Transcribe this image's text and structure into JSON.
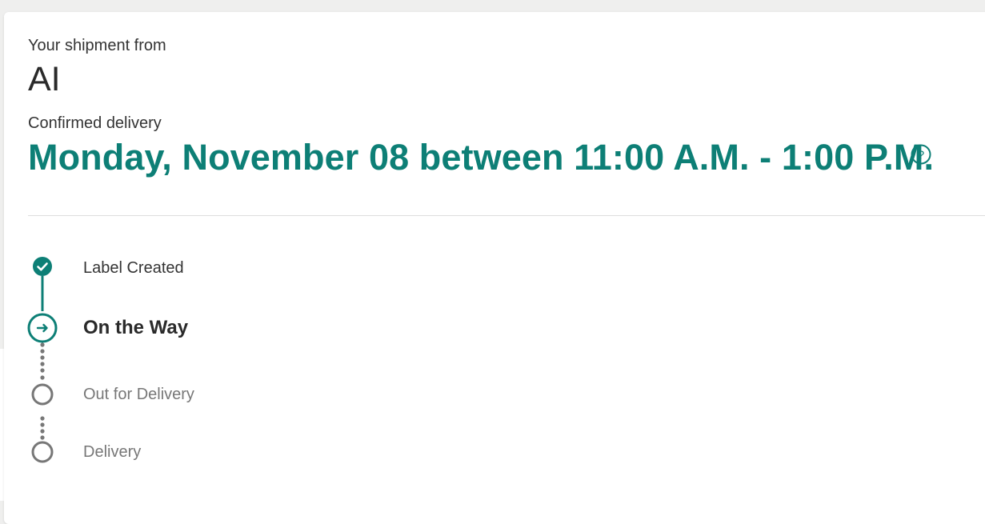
{
  "shipment": {
    "from_label": "Your shipment from",
    "shipper_name": "AI",
    "delivery_label": "Confirmed delivery",
    "delivery_window": "Monday, November 08 between 11:00 A.M. - 1:00 P.M."
  },
  "help": {
    "icon": "help-circle-icon",
    "glyph": "?"
  },
  "progress": {
    "steps": [
      {
        "label": "Label Created",
        "status": "complete",
        "icon": "check-circle-icon"
      },
      {
        "label": "On the Way",
        "status": "current",
        "icon": "arrow-circle-icon"
      },
      {
        "label": "Out for Delivery",
        "status": "pending",
        "icon": "empty-circle-icon"
      },
      {
        "label": "Delivery",
        "status": "pending",
        "icon": "empty-circle-icon"
      }
    ]
  },
  "colors": {
    "accent": "#0d7f76",
    "pending": "#777777",
    "background": "#efefee",
    "card": "#ffffff"
  }
}
